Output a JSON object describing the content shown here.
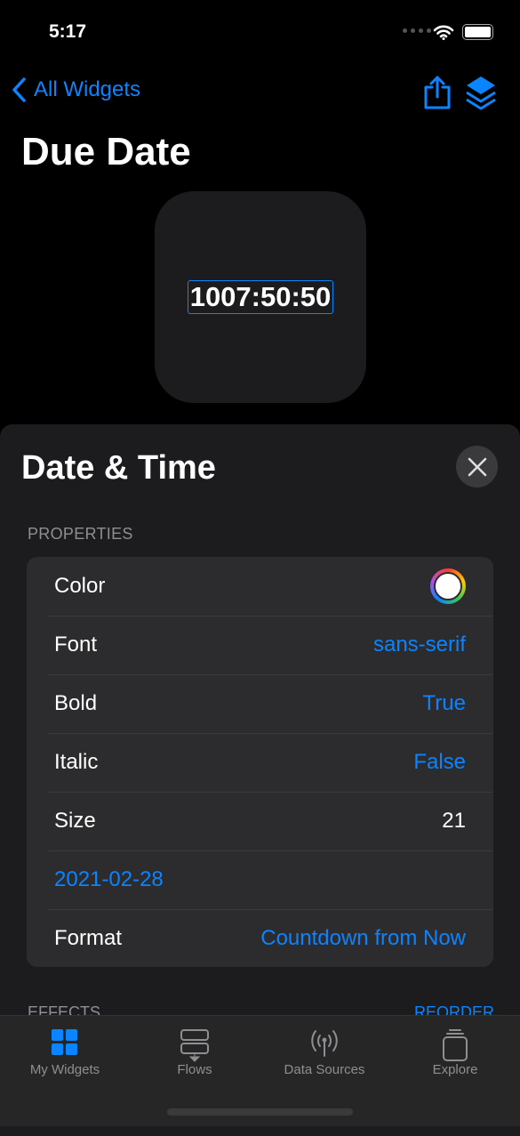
{
  "status": {
    "time": "5:17"
  },
  "nav": {
    "back_label": "All Widgets",
    "title": "Due Date"
  },
  "widget": {
    "text": "1007:50:50"
  },
  "sheet": {
    "title": "Date & Time",
    "section": "PROPERTIES",
    "rows": [
      {
        "label": "Color",
        "value": ""
      },
      {
        "label": "Font",
        "value": "sans-serif"
      },
      {
        "label": "Bold",
        "value": "True"
      },
      {
        "label": "Italic",
        "value": "False"
      },
      {
        "label": "Size",
        "value": "21"
      },
      {
        "label": "2021-02-28",
        "value": ""
      },
      {
        "label": "Format",
        "value": "Countdown from Now"
      }
    ],
    "effects": "EFFECTS",
    "reorder": "REORDER"
  },
  "tabs": [
    {
      "label": "My Widgets",
      "icon": "grid-icon",
      "active": true
    },
    {
      "label": "Flows",
      "icon": "flows-icon"
    },
    {
      "label": "Data Sources",
      "icon": "antenna-icon"
    },
    {
      "label": "Explore",
      "icon": "stack-icon"
    }
  ],
  "colors": {
    "accent": "#0a84ff"
  }
}
